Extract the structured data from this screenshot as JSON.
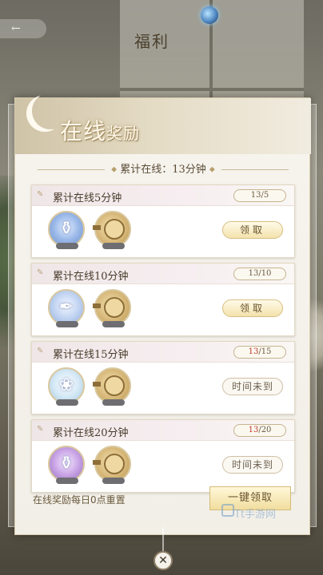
{
  "top": {
    "back_label": "←",
    "title": "福利"
  },
  "panel": {
    "title_main": "在线",
    "title_small": "奖励",
    "online_total": "累计在线：13分钟"
  },
  "tasks": [
    {
      "name": "累计在线5分钟",
      "progress_current": "13",
      "progress_sep": "/",
      "progress_target": "5",
      "current_met": true,
      "button": "领取",
      "state": "claimable"
    },
    {
      "name": "累计在线10分钟",
      "progress_current": "13",
      "progress_sep": "/",
      "progress_target": "10",
      "current_met": true,
      "button": "领取",
      "state": "claimable"
    },
    {
      "name": "累计在线15分钟",
      "progress_current": "13",
      "progress_sep": "/",
      "progress_target": "15",
      "current_met": false,
      "button": "时间未到",
      "state": "locked"
    },
    {
      "name": "累计在线20分钟",
      "progress_current": "13",
      "progress_sep": "/",
      "progress_target": "20",
      "current_met": false,
      "button": "时间未到",
      "state": "locked"
    }
  ],
  "footer": {
    "reset_note": "在线奖励每日0点重置",
    "claim_all": "一键领取",
    "watermark": "Tt手游网"
  },
  "colors": {
    "accent_gold": "#d8be82",
    "progress_unmet": "#c0392b"
  },
  "close_label": "✕"
}
